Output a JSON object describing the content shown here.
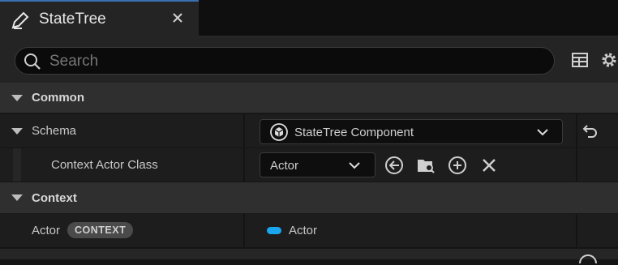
{
  "tab": {
    "title": "StateTree"
  },
  "search": {
    "placeholder": "Search",
    "value": ""
  },
  "categories": {
    "common": "Common",
    "context": "Context"
  },
  "properties": {
    "schema": {
      "label": "Schema",
      "value": "StateTree Component"
    },
    "context_actor_class": {
      "label": "Context Actor Class",
      "value": "Actor"
    },
    "actor": {
      "label": "Actor",
      "badge": "CONTEXT",
      "value": "Actor",
      "pill_color": "#1aa6ef"
    }
  },
  "colors": {
    "accent_tab": "#3a6fb0",
    "background": "#151515",
    "panel": "#242424",
    "category": "#2f2f2f"
  }
}
